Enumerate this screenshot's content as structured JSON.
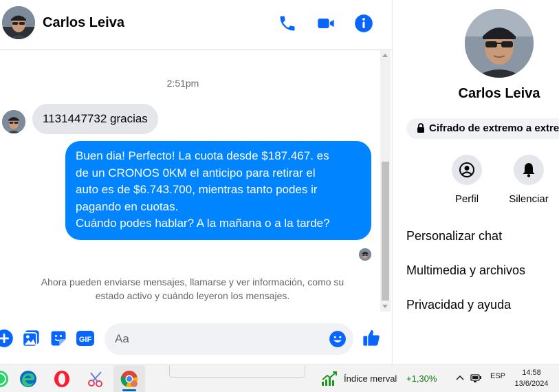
{
  "colors": {
    "accent": "#0084ff",
    "icon_blue": "#0866ff",
    "incoming_bubble": "#e4e6eb",
    "muted_text": "#65676b",
    "positive": "#0f7b0f"
  },
  "header": {
    "contact_name": "Carlos Leiva",
    "icons": [
      "phone-icon",
      "video-camera-icon",
      "info-icon"
    ]
  },
  "conversation": {
    "timestamp": "2:51pm",
    "incoming_message": "1131447732 gracias",
    "outgoing_message_lines": [
      "Buen dia! Perfecto! La cuota desde $187.467. es",
      "de un CRONOS 0KM el anticipo para retirar el",
      "auto es de $6.743.700, mientras tanto podes ir",
      "pagando en cuotas.",
      "Cuándo podes hablar? A la mañana o a la tarde?"
    ],
    "system_note_lines": [
      "Ahora pueden enviarse mensajes, llamarse y ver información, como su",
      "estado activo y cuándo leyeron los mensajes."
    ]
  },
  "composer": {
    "placeholder": "Aa",
    "icons": [
      "plus-icon",
      "photo-icon",
      "sticker-icon",
      "gif-icon",
      "emoji-icon",
      "thumbs-up-icon"
    ],
    "gif_label": "GIF"
  },
  "info_panel": {
    "contact_name": "Carlos Leiva",
    "encryption_label": "Cifrado de extremo a extremo",
    "actions": [
      {
        "label": "Perfil",
        "icon": "profile-icon"
      },
      {
        "label": "Silenciar",
        "icon": "bell-icon"
      }
    ],
    "menu": [
      "Personalizar chat",
      "Multimedia y archivos",
      "Privacidad y ayuda"
    ]
  },
  "taskbar": {
    "apps": [
      "whatsapp-icon",
      "edge-icon",
      "opera-icon",
      "snipping-tool-icon",
      "chrome-icon"
    ],
    "widget": {
      "name": "Índice merval",
      "change": "+1,30%"
    },
    "tray": {
      "language": "ESP"
    },
    "clock": {
      "time": "14:58",
      "date": "13/6/2024"
    }
  }
}
